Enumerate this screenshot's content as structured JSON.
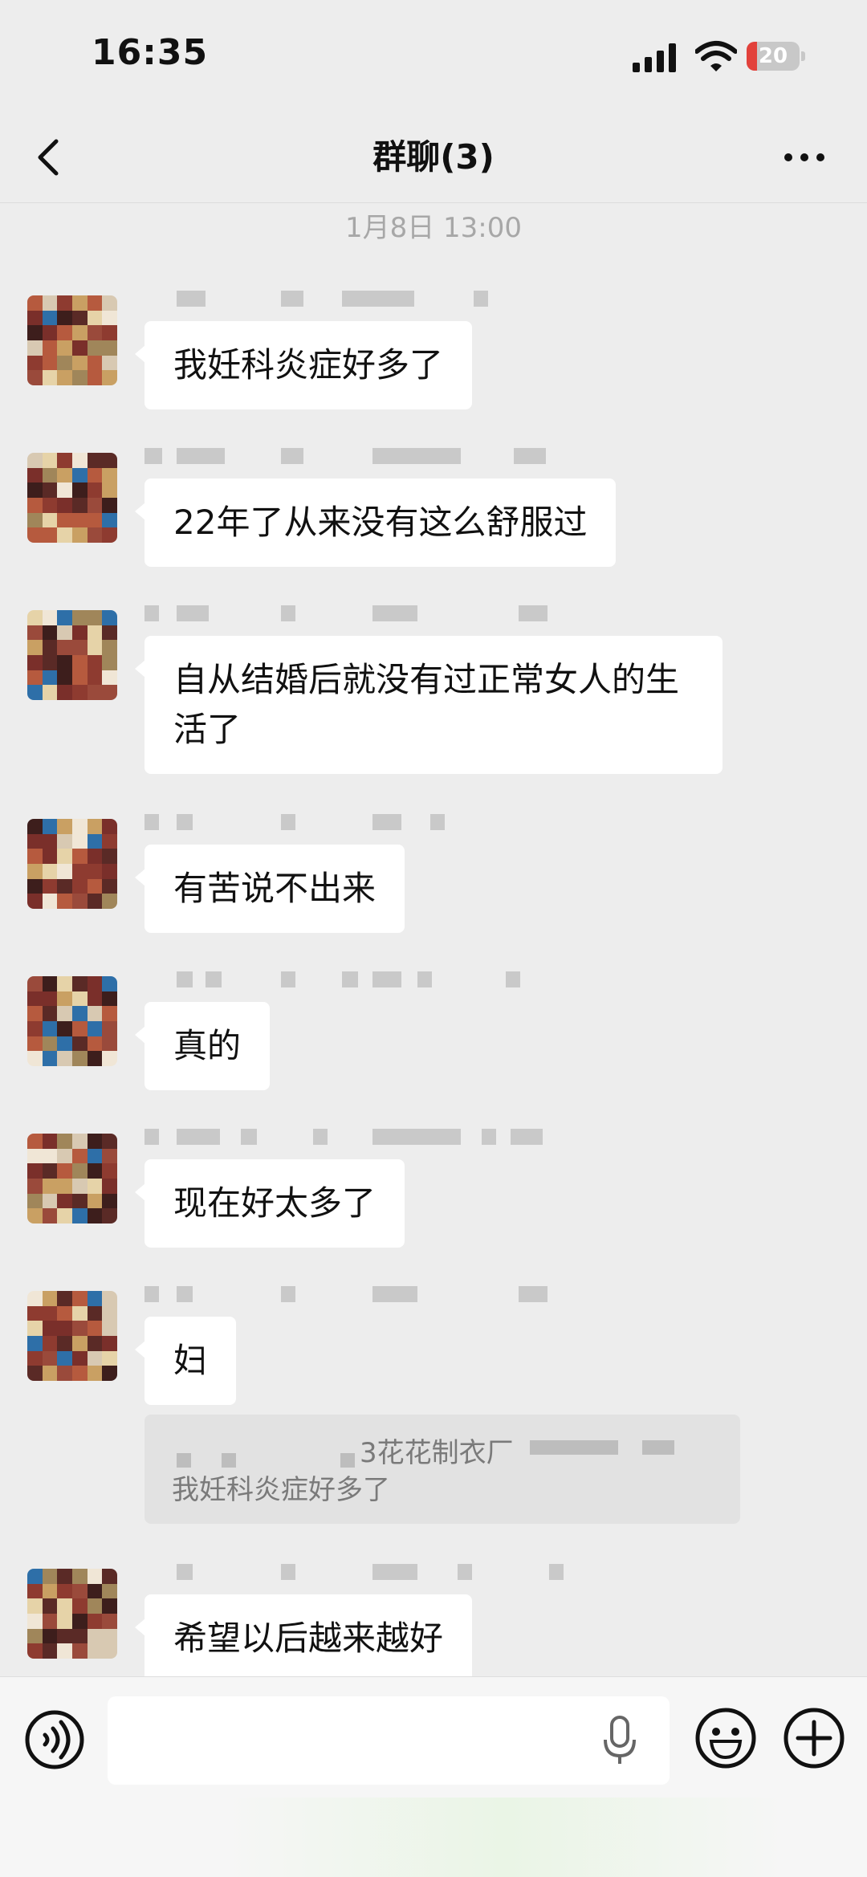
{
  "status_bar": {
    "time": "16:35",
    "battery": "20",
    "battery_level": 0.2
  },
  "header": {
    "title": "群聊(3)"
  },
  "timestamp": "1月8日 13:00",
  "messages": [
    {
      "text": "我妊科炎症好多了"
    },
    {
      "text": "22年了从来没有这么舒服过"
    },
    {
      "text": "自从结婚后就没有过正常女人的生活了"
    },
    {
      "text": "有苦说不出来"
    },
    {
      "text": "真的"
    },
    {
      "text": "现在好太多了"
    },
    {
      "text": "妇"
    },
    {
      "text": "希望以后越来越好"
    }
  ],
  "quote": {
    "name": "3花花制衣厂",
    "text": "我妊科炎症好多了"
  },
  "input": {
    "placeholder": ""
  },
  "colors": {
    "background": "#ededed",
    "bubble": "#ffffff",
    "quote_bg": "#e2e2e2",
    "battery_low": "#e2413b"
  },
  "icons": [
    "back-chevron-icon",
    "more-dots-icon",
    "signal-icon",
    "wifi-icon",
    "battery-icon",
    "voice-icon",
    "microphone-icon",
    "emoji-icon",
    "plus-icon"
  ]
}
